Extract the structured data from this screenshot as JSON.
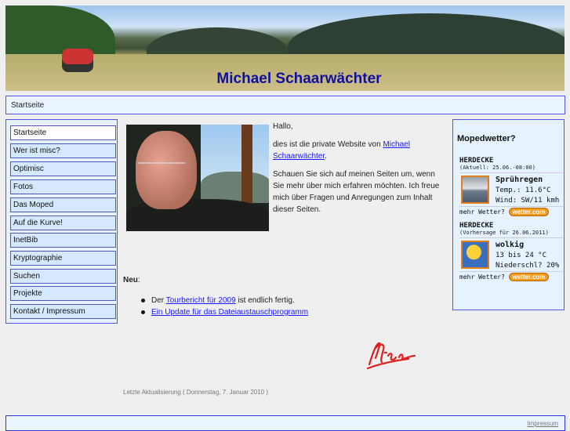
{
  "header": {
    "title": "Michael Schaarwächter"
  },
  "breadcrumb": {
    "current": "Startseite"
  },
  "sidebar": {
    "items": [
      {
        "label": "Startseite",
        "active": true
      },
      {
        "label": "Wer ist misc?"
      },
      {
        "label": "Optimisc"
      },
      {
        "label": "Fotos"
      },
      {
        "label": "Das Moped"
      },
      {
        "label": "Auf die Kurve!"
      },
      {
        "label": "InetBib"
      },
      {
        "label": "Kryptographie"
      },
      {
        "label": "Suchen"
      },
      {
        "label": "Projekte"
      },
      {
        "label": "Kontakt / Impressum"
      }
    ]
  },
  "main": {
    "greeting": "Hallo,",
    "intro_prefix": "dies ist die private Website von ",
    "intro_link": "Michael Schaarwächter",
    "intro_suffix": ".",
    "intro_body": "Schauen Sie sich auf meinen Seiten um, wenn Sie mehr über mich erfahren möchten. Ich freue mich über Fragen und Anregungen zum Inhalt dieser Seiten.",
    "news_label": "Neu",
    "news_colon": ":",
    "news": [
      {
        "prefix": "Der ",
        "link": "Tourbericht für 2009",
        "suffix": " ist endlich fertig."
      },
      {
        "prefix": "",
        "link": "Ein Update für das Dateiaustauschprogramm",
        "suffix": ""
      }
    ],
    "last_updated": "Letzte Aktualisierung ( Donnerstag, 7. Januar 2010 )"
  },
  "weather": {
    "title": "Mopedwetter?",
    "current": {
      "city": "HERDECKE",
      "sub": "(Aktuell: 25.06.-08:00)",
      "condition": "Sprühregen",
      "line1": "Temp.: 11.6°C",
      "line2": "Wind: SW/11 kmh",
      "more": "mehr Wetter?",
      "logo": "wetter.com"
    },
    "forecast": {
      "city": "HERDECKE",
      "sub": "(Vorhersage für 26.06.2011)",
      "condition": "wolkig",
      "line1": "13 bis 24 °C",
      "line2": "Niederschl? 20%",
      "more": "mehr Wetter?",
      "logo": "wetter.com"
    }
  },
  "footer": {
    "impressum": "Impressum"
  }
}
